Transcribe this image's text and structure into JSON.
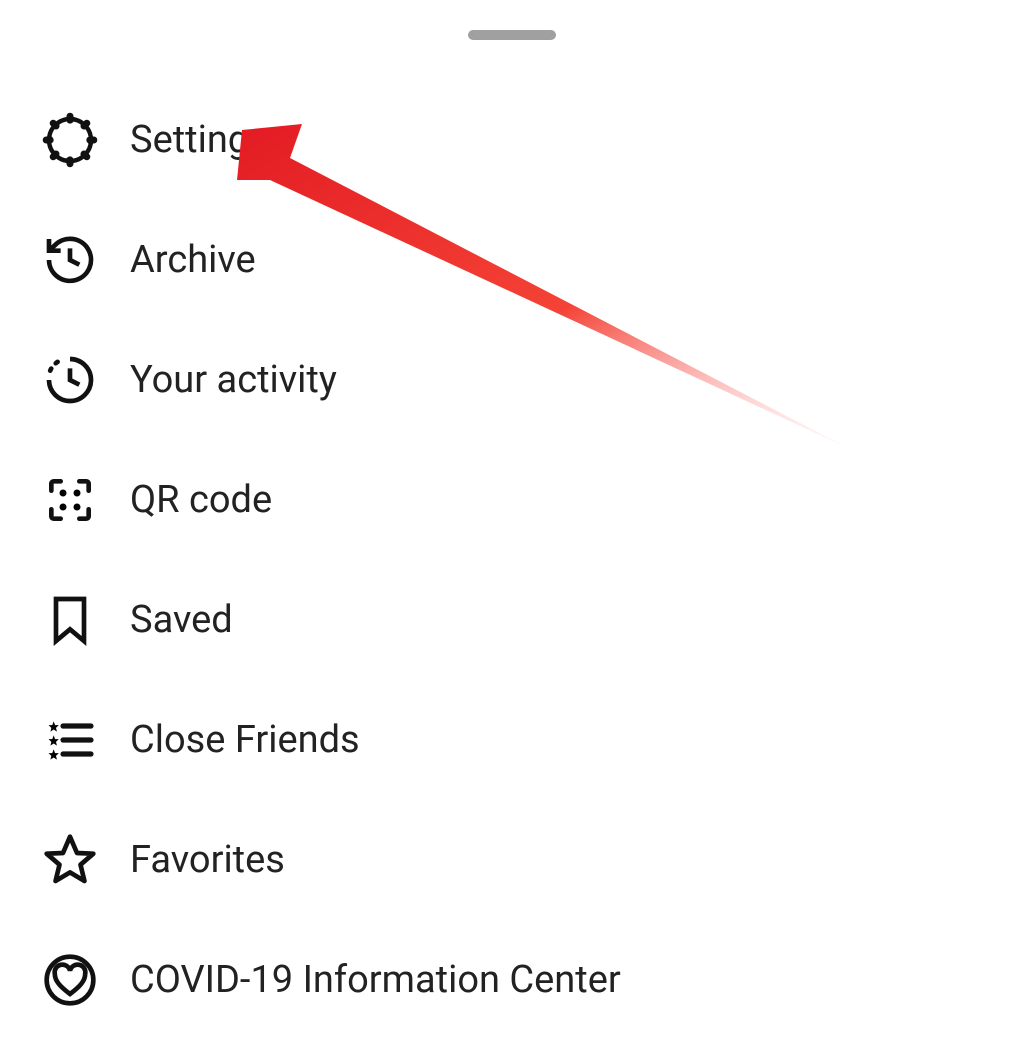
{
  "menu": {
    "items": [
      {
        "label": "Settings",
        "icon": "gear-icon"
      },
      {
        "label": "Archive",
        "icon": "history-icon"
      },
      {
        "label": "Your activity",
        "icon": "activity-icon"
      },
      {
        "label": "QR code",
        "icon": "qr-code-icon"
      },
      {
        "label": "Saved",
        "icon": "bookmark-icon"
      },
      {
        "label": "Close Friends",
        "icon": "close-friends-icon"
      },
      {
        "label": "Favorites",
        "icon": "star-icon"
      },
      {
        "label": "COVID-19 Information Center",
        "icon": "covid-info-icon"
      }
    ]
  },
  "annotation": {
    "type": "arrow",
    "color": "#e53935",
    "target": "menu-item-settings"
  }
}
